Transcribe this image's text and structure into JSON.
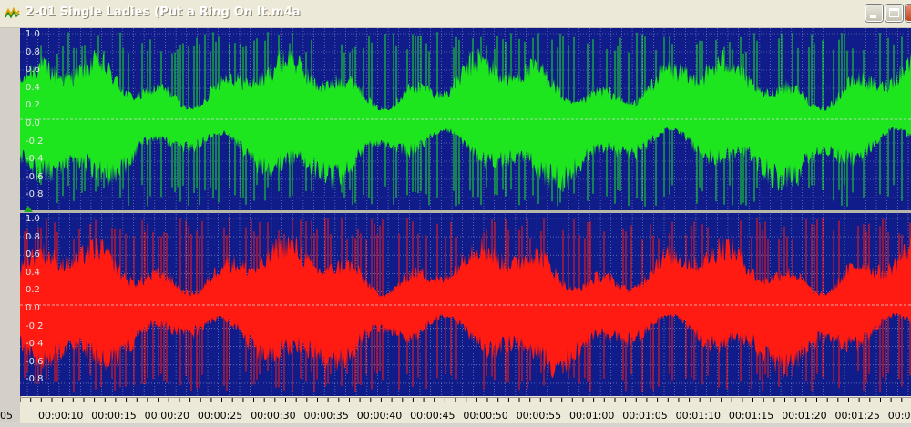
{
  "window": {
    "title": "2-01 Single Ladies (Put a Ring On It.m4a",
    "controls": [
      "minimize-button",
      "maximize-button",
      "close-button"
    ]
  },
  "colors": {
    "background": "#0f1c8a",
    "grid": "#8b93c8",
    "left_channel": "#1ee61e",
    "right_channel": "#ff1a12",
    "center_line": "#d8d8d8",
    "play_marker": "#1fa81f"
  },
  "channels": [
    {
      "name": "left",
      "amplitude_labels": [
        "1.0",
        "0.8",
        "0.6",
        "0.4",
        "0.2",
        "0.0",
        "-0.2",
        "-0.4",
        "-0.6",
        "-0.8"
      ]
    },
    {
      "name": "right",
      "amplitude_labels": [
        "1.0",
        "0.8",
        "0.6",
        "0.4",
        "0.2",
        "0.0",
        "-0.2",
        "-0.4",
        "-0.6",
        "-0.8"
      ]
    }
  ],
  "timeline": {
    "first_partial_label": "05",
    "labels": [
      "00:00:10",
      "00:00:15",
      "00:00:20",
      "00:00:25",
      "00:00:30",
      "00:00:35",
      "00:00:40",
      "00:00:45",
      "00:00:50",
      "00:00:55",
      "00:01:00",
      "00:01:05",
      "00:01:10",
      "00:01:15",
      "00:01:20",
      "00:01:25",
      "00:0"
    ],
    "major_interval_seconds": 5
  }
}
